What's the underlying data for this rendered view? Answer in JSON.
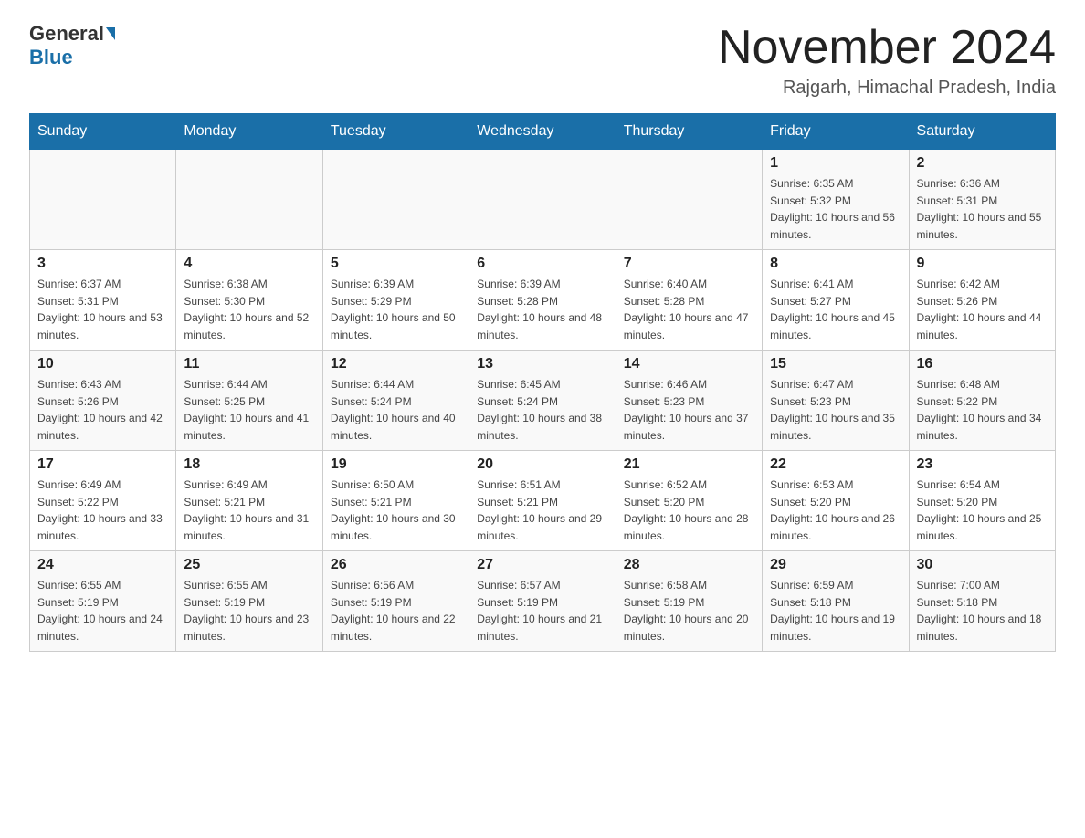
{
  "header": {
    "logo_general": "General",
    "logo_blue": "Blue",
    "month_title": "November 2024",
    "location": "Rajgarh, Himachal Pradesh, India"
  },
  "weekdays": [
    "Sunday",
    "Monday",
    "Tuesday",
    "Wednesday",
    "Thursday",
    "Friday",
    "Saturday"
  ],
  "weeks": [
    [
      {
        "day": "",
        "info": ""
      },
      {
        "day": "",
        "info": ""
      },
      {
        "day": "",
        "info": ""
      },
      {
        "day": "",
        "info": ""
      },
      {
        "day": "",
        "info": ""
      },
      {
        "day": "1",
        "info": "Sunrise: 6:35 AM\nSunset: 5:32 PM\nDaylight: 10 hours and 56 minutes."
      },
      {
        "day": "2",
        "info": "Sunrise: 6:36 AM\nSunset: 5:31 PM\nDaylight: 10 hours and 55 minutes."
      }
    ],
    [
      {
        "day": "3",
        "info": "Sunrise: 6:37 AM\nSunset: 5:31 PM\nDaylight: 10 hours and 53 minutes."
      },
      {
        "day": "4",
        "info": "Sunrise: 6:38 AM\nSunset: 5:30 PM\nDaylight: 10 hours and 52 minutes."
      },
      {
        "day": "5",
        "info": "Sunrise: 6:39 AM\nSunset: 5:29 PM\nDaylight: 10 hours and 50 minutes."
      },
      {
        "day": "6",
        "info": "Sunrise: 6:39 AM\nSunset: 5:28 PM\nDaylight: 10 hours and 48 minutes."
      },
      {
        "day": "7",
        "info": "Sunrise: 6:40 AM\nSunset: 5:28 PM\nDaylight: 10 hours and 47 minutes."
      },
      {
        "day": "8",
        "info": "Sunrise: 6:41 AM\nSunset: 5:27 PM\nDaylight: 10 hours and 45 minutes."
      },
      {
        "day": "9",
        "info": "Sunrise: 6:42 AM\nSunset: 5:26 PM\nDaylight: 10 hours and 44 minutes."
      }
    ],
    [
      {
        "day": "10",
        "info": "Sunrise: 6:43 AM\nSunset: 5:26 PM\nDaylight: 10 hours and 42 minutes."
      },
      {
        "day": "11",
        "info": "Sunrise: 6:44 AM\nSunset: 5:25 PM\nDaylight: 10 hours and 41 minutes."
      },
      {
        "day": "12",
        "info": "Sunrise: 6:44 AM\nSunset: 5:24 PM\nDaylight: 10 hours and 40 minutes."
      },
      {
        "day": "13",
        "info": "Sunrise: 6:45 AM\nSunset: 5:24 PM\nDaylight: 10 hours and 38 minutes."
      },
      {
        "day": "14",
        "info": "Sunrise: 6:46 AM\nSunset: 5:23 PM\nDaylight: 10 hours and 37 minutes."
      },
      {
        "day": "15",
        "info": "Sunrise: 6:47 AM\nSunset: 5:23 PM\nDaylight: 10 hours and 35 minutes."
      },
      {
        "day": "16",
        "info": "Sunrise: 6:48 AM\nSunset: 5:22 PM\nDaylight: 10 hours and 34 minutes."
      }
    ],
    [
      {
        "day": "17",
        "info": "Sunrise: 6:49 AM\nSunset: 5:22 PM\nDaylight: 10 hours and 33 minutes."
      },
      {
        "day": "18",
        "info": "Sunrise: 6:49 AM\nSunset: 5:21 PM\nDaylight: 10 hours and 31 minutes."
      },
      {
        "day": "19",
        "info": "Sunrise: 6:50 AM\nSunset: 5:21 PM\nDaylight: 10 hours and 30 minutes."
      },
      {
        "day": "20",
        "info": "Sunrise: 6:51 AM\nSunset: 5:21 PM\nDaylight: 10 hours and 29 minutes."
      },
      {
        "day": "21",
        "info": "Sunrise: 6:52 AM\nSunset: 5:20 PM\nDaylight: 10 hours and 28 minutes."
      },
      {
        "day": "22",
        "info": "Sunrise: 6:53 AM\nSunset: 5:20 PM\nDaylight: 10 hours and 26 minutes."
      },
      {
        "day": "23",
        "info": "Sunrise: 6:54 AM\nSunset: 5:20 PM\nDaylight: 10 hours and 25 minutes."
      }
    ],
    [
      {
        "day": "24",
        "info": "Sunrise: 6:55 AM\nSunset: 5:19 PM\nDaylight: 10 hours and 24 minutes."
      },
      {
        "day": "25",
        "info": "Sunrise: 6:55 AM\nSunset: 5:19 PM\nDaylight: 10 hours and 23 minutes."
      },
      {
        "day": "26",
        "info": "Sunrise: 6:56 AM\nSunset: 5:19 PM\nDaylight: 10 hours and 22 minutes."
      },
      {
        "day": "27",
        "info": "Sunrise: 6:57 AM\nSunset: 5:19 PM\nDaylight: 10 hours and 21 minutes."
      },
      {
        "day": "28",
        "info": "Sunrise: 6:58 AM\nSunset: 5:19 PM\nDaylight: 10 hours and 20 minutes."
      },
      {
        "day": "29",
        "info": "Sunrise: 6:59 AM\nSunset: 5:18 PM\nDaylight: 10 hours and 19 minutes."
      },
      {
        "day": "30",
        "info": "Sunrise: 7:00 AM\nSunset: 5:18 PM\nDaylight: 10 hours and 18 minutes."
      }
    ]
  ]
}
